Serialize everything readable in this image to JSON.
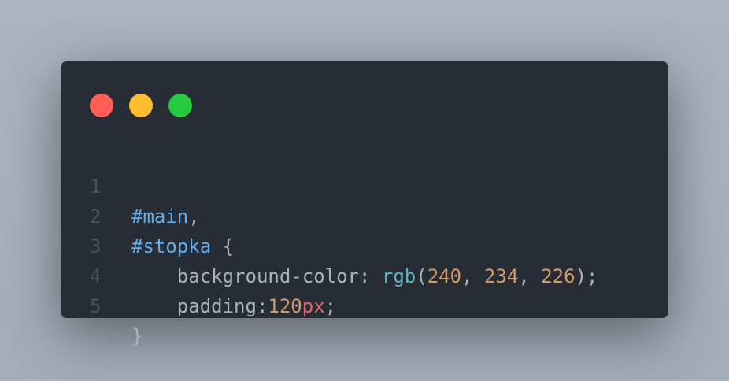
{
  "window_controls": {
    "close_color": "#ff5f56",
    "minimize_color": "#ffbd2e",
    "maximize_color": "#27c93f"
  },
  "code": {
    "lines": [
      {
        "number": "1",
        "tokens": [
          {
            "text": "#main",
            "kind": "selector"
          },
          {
            "text": ",",
            "kind": "text"
          }
        ]
      },
      {
        "number": "2",
        "tokens": [
          {
            "text": "#stopka",
            "kind": "selector"
          },
          {
            "text": " {",
            "kind": "text"
          }
        ]
      },
      {
        "number": "3",
        "tokens": [
          {
            "text": "    background-color: ",
            "kind": "text"
          },
          {
            "text": "rgb",
            "kind": "function"
          },
          {
            "text": "(",
            "kind": "text"
          },
          {
            "text": "240",
            "kind": "number"
          },
          {
            "text": ", ",
            "kind": "text"
          },
          {
            "text": "234",
            "kind": "number"
          },
          {
            "text": ", ",
            "kind": "text"
          },
          {
            "text": "226",
            "kind": "number"
          },
          {
            "text": ");",
            "kind": "text"
          }
        ]
      },
      {
        "number": "4",
        "tokens": [
          {
            "text": "    padding:",
            "kind": "text"
          },
          {
            "text": "120",
            "kind": "number"
          },
          {
            "text": "px",
            "kind": "unit"
          },
          {
            "text": ";",
            "kind": "text"
          }
        ]
      },
      {
        "number": "5",
        "tokens": [
          {
            "text": "}",
            "kind": "text"
          }
        ]
      }
    ]
  }
}
